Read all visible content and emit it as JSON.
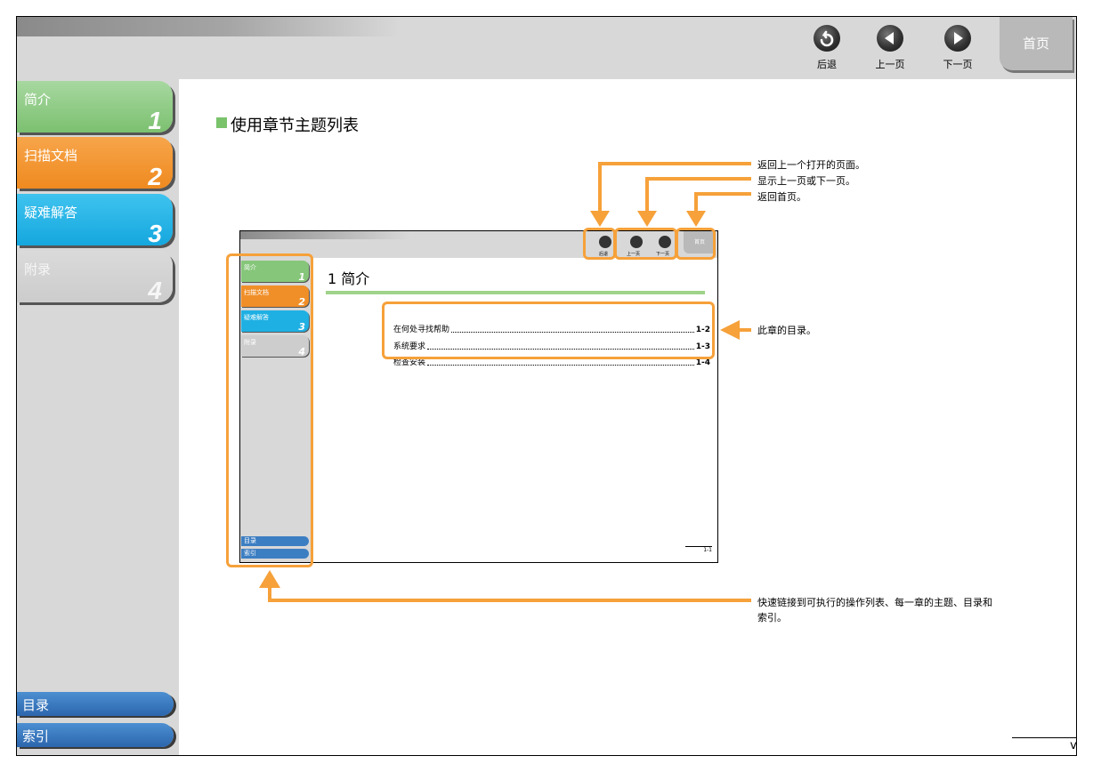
{
  "nav": {
    "back_label": "后退",
    "prev_label": "上一页",
    "next_label": "下一页",
    "home_label": "首页"
  },
  "sidebar": {
    "tabs": [
      {
        "label": "简介",
        "num": "1"
      },
      {
        "label": "扫描文档",
        "num": "2"
      },
      {
        "label": "疑难解答",
        "num": "3"
      },
      {
        "label": "附录",
        "num": "4"
      }
    ],
    "contents_label": "目录",
    "index_label": "索引"
  },
  "main": {
    "title": "使用章节主题列表",
    "annotations": {
      "back": "返回上一个打开的页面。",
      "prevnext": "显示上一页或下一页。",
      "home": "返回首页。",
      "toc": "此章的目录。",
      "quicklinks_line1": "快速链接到可执行的操作列表、每一章的主题、目录和",
      "quicklinks_line2": "索引。"
    },
    "page_number": "vii"
  },
  "mini": {
    "back_label": "后退",
    "prev_label": "上一页",
    "next_label": "下一页",
    "home_label": "首页",
    "tabs": [
      {
        "label": "简介",
        "num": "1"
      },
      {
        "label": "扫描文档",
        "num": "2"
      },
      {
        "label": "疑难解答",
        "num": "3"
      },
      {
        "label": "附录",
        "num": "4"
      }
    ],
    "contents_label": "目录",
    "index_label": "索引",
    "chapter_title": "1 简介",
    "toc": [
      {
        "title": "在何处寻找帮助",
        "page": "1-2"
      },
      {
        "title": "系统要求",
        "page": "1-3"
      },
      {
        "title": "检查安装",
        "page": "1-4"
      }
    ],
    "page_number": "1-1"
  },
  "colors": {
    "accent_orange": "#f6a13a",
    "tab1_green": "#7cc070",
    "tab2_orange": "#ef8a1f",
    "tab3_blue": "#15a7de",
    "tab4_gray": "#cccccc",
    "bottom_tab_blue": "#2c66ad"
  }
}
